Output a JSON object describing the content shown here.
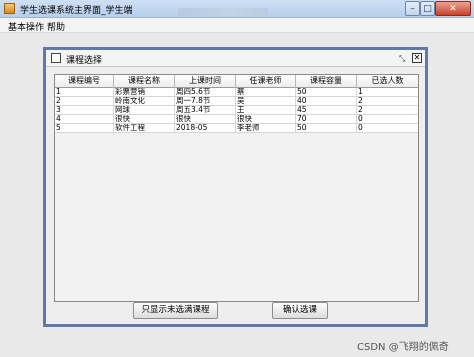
{
  "window": {
    "title": "学生选课系统主界面_学生端",
    "close_glyph": "✕",
    "min_glyph": "–",
    "max_glyph": "□"
  },
  "menu": {
    "items": [
      "基本操作",
      "帮助"
    ]
  },
  "internal_frame": {
    "title": "课程选择",
    "close_glyph": "✕",
    "restore_glyph": "⤡"
  },
  "table": {
    "columns": [
      "课程编号",
      "课程名称",
      "上课时间",
      "任课老师",
      "课程容量",
      "已选人数"
    ],
    "rows": [
      [
        "1",
        "彩票营销",
        "周四5.6节",
        "蔡",
        "50",
        "1"
      ],
      [
        "2",
        "岭南文化",
        "周一7.8节",
        "吴",
        "40",
        "2"
      ],
      [
        "3",
        "网球",
        "周五3.4节",
        "王",
        "45",
        "2"
      ],
      [
        "4",
        "很快",
        "很快",
        "很快",
        "70",
        "0"
      ],
      [
        "5",
        "软件工程",
        "2018-05",
        "李老师",
        "50",
        "0"
      ]
    ]
  },
  "buttons": {
    "filter_label": "只显示未选满课程",
    "confirm_label": "确认选课"
  },
  "watermark": "CSDN @飞翔的佩奇"
}
